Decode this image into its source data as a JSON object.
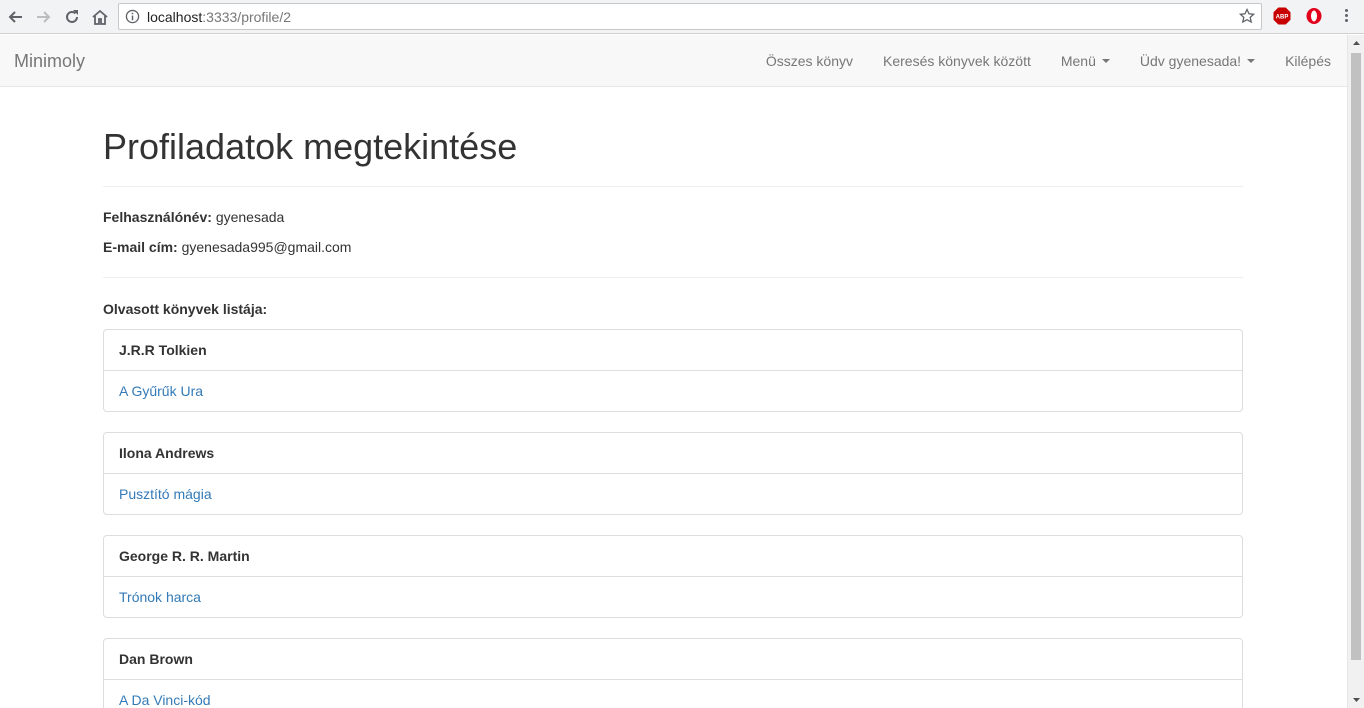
{
  "browser": {
    "url_host": "localhost",
    "url_path": ":3333/profile/2",
    "icons": [
      "back-icon",
      "forward-icon",
      "reload-icon",
      "home-icon",
      "info-icon",
      "star-icon",
      "adblock-icon",
      "opera-icon",
      "menu-icon"
    ],
    "extensions": {
      "adblock_label": "ABP"
    }
  },
  "navbar": {
    "brand": "Minimoly",
    "links": [
      {
        "label": "Összes könyv"
      },
      {
        "label": "Keresés könyvek között"
      },
      {
        "label": "Menü",
        "dropdown": true
      },
      {
        "label": "Üdv gyenesada!",
        "dropdown": true
      },
      {
        "label": "Kilépés"
      }
    ]
  },
  "profile": {
    "title": "Profiladatok megtekintése",
    "username_label": "Felhasználónév:",
    "username": "gyenesada",
    "email_label": "E-mail cím:",
    "email": "gyenesada995@gmail.com",
    "books_title": "Olvasott könyvek listája:",
    "books": [
      {
        "author": "J.R.R Tolkien",
        "title": "A Gyűrűk Ura"
      },
      {
        "author": "Ilona Andrews",
        "title": "Pusztító mágia"
      },
      {
        "author": "George R. R. Martin",
        "title": "Trónok harca"
      },
      {
        "author": "Dan Brown",
        "title": "A Da Vinci-kód"
      }
    ]
  },
  "colors": {
    "link": "#337ab7",
    "navbar_bg": "#f8f8f8",
    "text": "#333333"
  }
}
